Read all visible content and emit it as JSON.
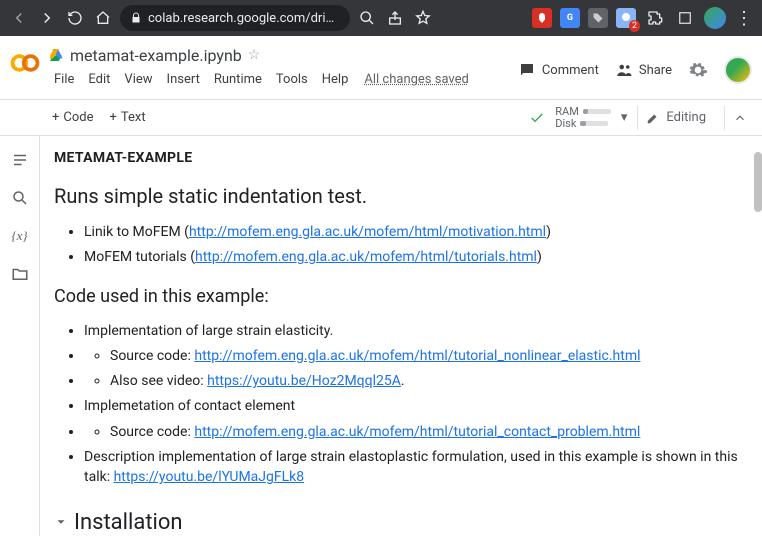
{
  "browser": {
    "url": "colab.research.google.com/dri…",
    "badge": "2"
  },
  "doc": {
    "title": "metamat-example.ipynb",
    "menu": [
      "File",
      "Edit",
      "View",
      "Insert",
      "Runtime",
      "Tools",
      "Help"
    ],
    "save_status": "All changes saved"
  },
  "header": {
    "comment": "Comment",
    "share": "Share"
  },
  "toolbar": {
    "code": "Code",
    "text": "Text",
    "ram": "RAM",
    "disk": "Disk",
    "editing": "Editing"
  },
  "sidebar": {
    "items": [
      "toc",
      "search",
      "vars",
      "files"
    ]
  },
  "content": {
    "meta_title": "METAMAT-EXAMPLE",
    "subtitle": "Runs simple static indentation test.",
    "l1_prefix": "Linik to MoFEM (",
    "l1_link": "http://mofem.eng.gla.ac.uk/mofem/html/motivation.html",
    "l1_suffix": ")",
    "l2_prefix": "MoFEM tutorials (",
    "l2_link": "http://mofem.eng.gla.ac.uk/mofem/html/tutorials.html",
    "l2_suffix": ")",
    "sec2": "Code used in this example:",
    "c1": "Implementation of large strain elasticity.",
    "c1a_prefix": "Source code: ",
    "c1a_link": "http://mofem.eng.gla.ac.uk/mofem/html/tutorial_nonlinear_elastic.html",
    "c1b_prefix": "Also see video: ",
    "c1b_link": "https://youtu.be/Hoz2Mqql25A",
    "c1b_suffix": ".",
    "c2": "Implemetation of contact element",
    "c2a_prefix": "Source code: ",
    "c2a_link": "http://mofem.eng.gla.ac.uk/mofem/html/tutorial_contact_problem.html",
    "c3_prefix": "Description implementation of large strain elastoplastic formulation, used in this example is shown in this talk: ",
    "c3_link": "https://youtu.be/lYUMaJgFLk8",
    "install": "Installation"
  }
}
